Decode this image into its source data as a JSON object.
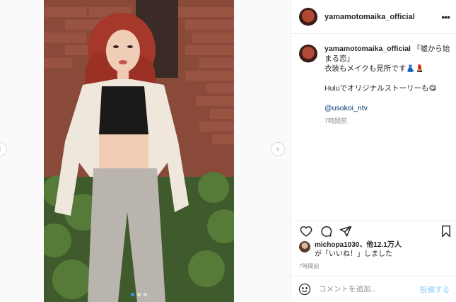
{
  "post": {
    "username": "yamamotomaika_official",
    "more_label": "•••",
    "caption": {
      "username": "yamamotomaika_official",
      "line1": "「嘘から始まる恋」",
      "line2": "衣装もメイクも見所です👗💄",
      "line3": "Huluでオリジナルストーリーも😋",
      "mention": "@usokoi_ntv",
      "time": "7時間前"
    },
    "likes": {
      "user": "michopa1030",
      "rest": "、他12.1万人",
      "line2": "が「いいね！」しました"
    },
    "posted_time": "7時間前",
    "comment": {
      "placeholder": "コメントを追加...",
      "post_label": "投稿する"
    },
    "carousel": {
      "current": 1,
      "total": 3
    }
  },
  "icons": {
    "more": "more-icon",
    "heart": "heart-icon",
    "comment": "comment-icon",
    "share": "share-icon",
    "bookmark": "bookmark-icon",
    "emoji": "emoji-icon",
    "chevron_right": "chevron-right-icon",
    "chevron_left": "chevron-left-icon"
  },
  "colors": {
    "link": "#00376b",
    "muted": "#8e8e8e",
    "post_disabled": "#b2dffc",
    "carousel_active": "#3897f0"
  }
}
